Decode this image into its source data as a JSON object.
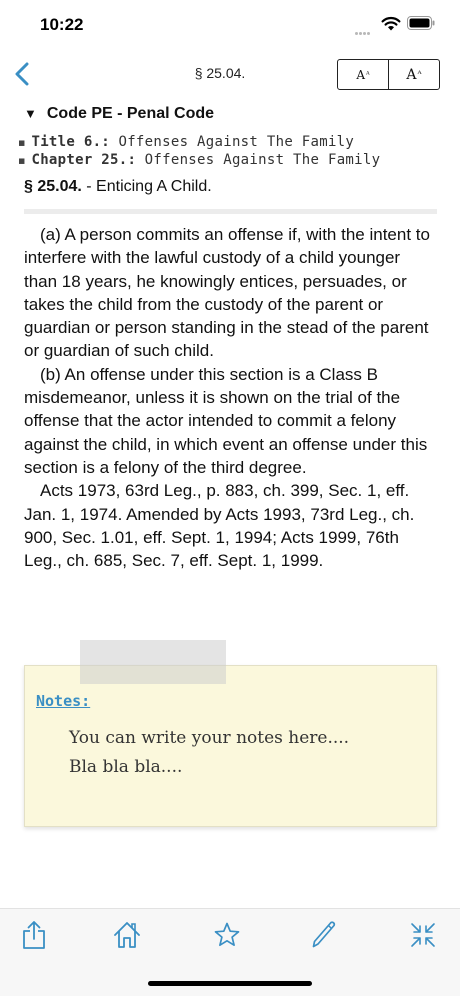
{
  "status_bar": {
    "time": "10:22"
  },
  "nav": {
    "title": "§ 25.04.",
    "font_decrease_label": "A",
    "font_increase_label": "A"
  },
  "header": {
    "code": "Code PE - Penal Code",
    "crumbs": [
      {
        "key": "Title 6.:",
        "value": "Offenses Against The Family"
      },
      {
        "key": "Chapter 25.:",
        "value": "Offenses Against The Family"
      }
    ],
    "section_number": "§ 25.04.",
    "section_title": " - Enticing A Child."
  },
  "body": {
    "paragraphs": [
      "(a) A person commits an offense if, with the intent to interfere with the lawful custody of a child younger than 18 years, he knowingly entices, persuades, or takes the child from the custody of the parent or guardian or person standing in the stead of the parent or guardian of such child.",
      "(b) An offense under this section is a Class B misdemeanor, unless it is shown on the trial of the offense that the actor intended to commit a felony against the child, in which event an offense under this section is a felony of the third degree.",
      "Acts 1973, 63rd Leg., p. 883, ch. 399, Sec. 1, eff. Jan. 1, 1974. Amended by Acts 1993, 73rd Leg., ch. 900, Sec. 1.01, eff. Sept. 1, 1994; Acts 1999, 76th Leg., ch. 685, Sec. 7, eff. Sept. 1, 1999."
    ]
  },
  "notes": {
    "label": "Notes:",
    "lines": [
      "You can write your notes here....",
      "Bla bla bla...."
    ]
  },
  "colors": {
    "accent": "#3a8fc4",
    "notes_background": "#fbf8dc",
    "toolbar_background": "#f7f7f7"
  },
  "toolbar": {
    "icons": [
      "share-icon",
      "home-icon",
      "star-icon",
      "pencil-icon",
      "collapse-icon"
    ]
  }
}
